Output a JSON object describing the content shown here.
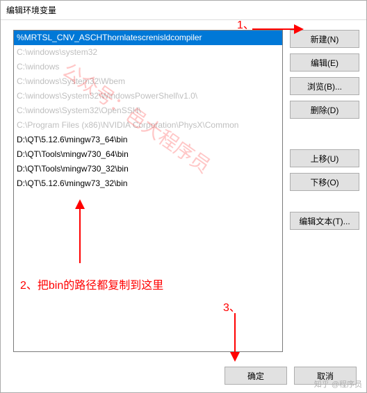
{
  "titlebar": {
    "text": "编辑环境变量"
  },
  "list_items": [
    {
      "text": "%MRTSL_CNV_ASCHThornlatescrenisldcompiler",
      "selected": true
    },
    {
      "text": "C:\\windows\\system32",
      "selected": false,
      "blur": true
    },
    {
      "text": "C:\\windows",
      "selected": false,
      "blur": true
    },
    {
      "text": "C:\\windows\\System32\\Wbem",
      "selected": false,
      "blur": true
    },
    {
      "text": "C:\\windows\\System32\\WindowsPowerShell\\v1.0\\",
      "selected": false,
      "blur": true
    },
    {
      "text": "C:\\windows\\System32\\OpenSSH\\",
      "selected": false,
      "blur": true
    },
    {
      "text": "C:\\Program Files (x86)\\NVIDIA Corporation\\PhysX\\Common",
      "selected": false,
      "blur": true
    },
    {
      "text": "D:\\QT\\5.12.6\\mingw73_64\\bin",
      "selected": false
    },
    {
      "text": "D:\\QT\\Tools\\mingw730_64\\bin",
      "selected": false
    },
    {
      "text": "D:\\QT\\Tools\\mingw730_32\\bin",
      "selected": false
    },
    {
      "text": "D:\\QT\\5.12.6\\mingw73_32\\bin",
      "selected": false
    }
  ],
  "buttons": {
    "new_btn": "新建(N)",
    "edit_btn": "编辑(E)",
    "browse_btn": "浏览(B)...",
    "delete_btn": "删除(D)",
    "up_btn": "上移(U)",
    "down_btn": "下移(O)",
    "edittext_btn": "编辑文本(T)...",
    "ok_btn": "确定",
    "cancel_btn": "取消"
  },
  "annotations": {
    "a1": "1、",
    "a2": "2、把bin的路径都复制到这里",
    "a3": "3、",
    "watermark": "公众号：邑大程序员",
    "attrib": "知乎 @程序员"
  }
}
